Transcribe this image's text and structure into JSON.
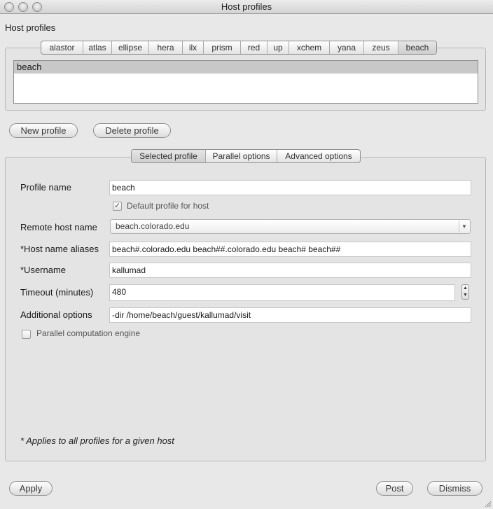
{
  "window": {
    "title": "Host profiles"
  },
  "host_profiles": {
    "label": "Host profiles",
    "hosts": [
      "alastor",
      "atlas",
      "ellipse",
      "hera",
      "ilx",
      "prism",
      "red",
      "up",
      "xchem",
      "yana",
      "zeus",
      "beach"
    ],
    "selected_host": "beach",
    "profiles": [
      "beach"
    ]
  },
  "actions": {
    "new_profile": "New profile",
    "delete_profile": "Delete profile"
  },
  "detail_tabs": [
    "Selected profile",
    "Parallel options",
    "Advanced options"
  ],
  "form": {
    "profile_name": {
      "label": "Profile name",
      "value": "beach"
    },
    "default_profile": {
      "label": "Default profile for host",
      "checked": true
    },
    "remote_host": {
      "label": "Remote host name",
      "value": "beach.colorado.edu"
    },
    "aliases": {
      "label": "*Host name aliases",
      "value": "beach#.colorado.edu beach##.colorado.edu beach# beach##"
    },
    "username": {
      "label": "*Username",
      "value": "kallumad"
    },
    "timeout": {
      "label": "Timeout (minutes)",
      "value": "480"
    },
    "additional": {
      "label": "Additional options",
      "value": "-dir /home/beach/guest/kallumad/visit"
    },
    "parallel_engine": {
      "label": "Parallel computation engine",
      "checked": false
    }
  },
  "note": "* Applies to all profiles for a given host",
  "bottom": {
    "apply": "Apply",
    "post": "Post",
    "dismiss": "Dismiss"
  }
}
